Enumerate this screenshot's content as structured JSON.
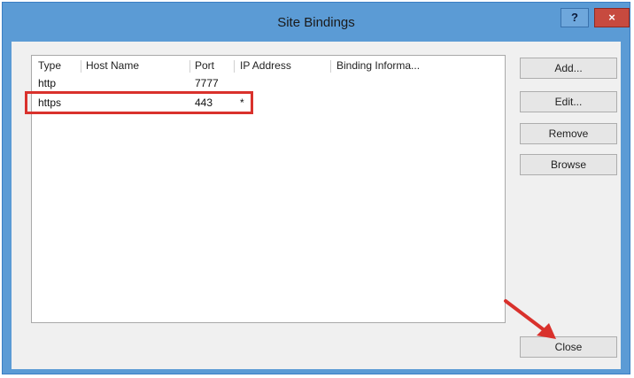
{
  "window": {
    "title": "Site Bindings",
    "help_label": "?",
    "close_glyph": "×"
  },
  "columns": [
    "Type",
    "Host Name",
    "Port",
    "IP Address",
    "Binding Informa..."
  ],
  "rows": [
    {
      "type": "http",
      "host": "",
      "port": "7777",
      "ip": "",
      "info": ""
    },
    {
      "type": "https",
      "host": "",
      "port": "443",
      "ip": "*",
      "info": ""
    }
  ],
  "buttons": {
    "add": "Add...",
    "edit": "Edit...",
    "remove": "Remove",
    "browse": "Browse",
    "close": "Close"
  },
  "annotation_color": "#d9312c"
}
